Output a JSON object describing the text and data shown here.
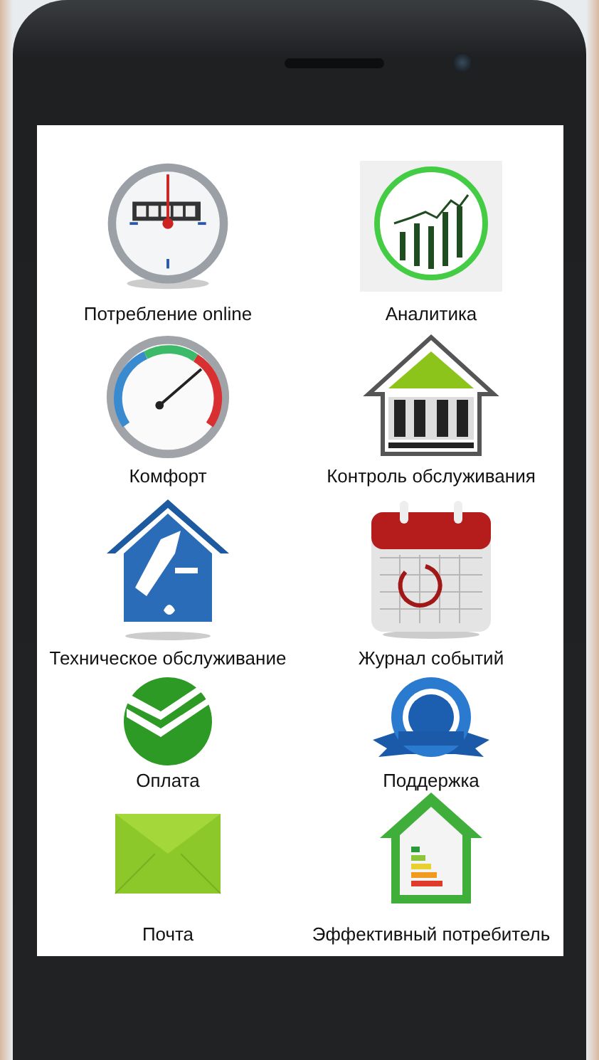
{
  "tiles": [
    {
      "label": "Потребление online",
      "kind": "meter"
    },
    {
      "label": "Аналитика",
      "kind": "chart"
    },
    {
      "label": "Комфорт",
      "kind": "gauge"
    },
    {
      "label": "Контроль обслуживания",
      "kind": "house"
    },
    {
      "label": "Техническое обслуживание",
      "kind": "plumbing"
    },
    {
      "label": "Журнал событий",
      "kind": "calendar"
    },
    {
      "label": "Оплата",
      "kind": "check"
    },
    {
      "label": "Поддержка",
      "kind": "seal"
    },
    {
      "label": "Почта",
      "kind": "envelope"
    },
    {
      "label": "Эффективный потребитель",
      "kind": "energy"
    }
  ]
}
